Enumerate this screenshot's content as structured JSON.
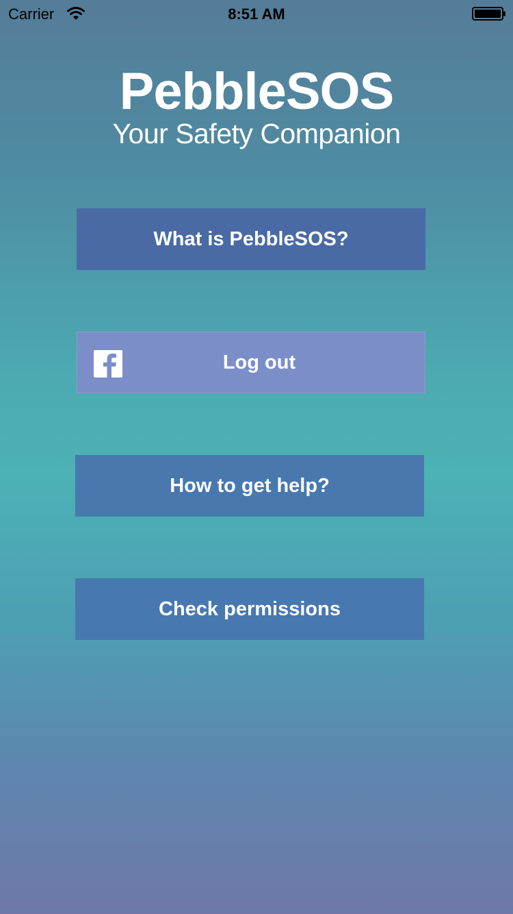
{
  "status_bar": {
    "carrier": "Carrier",
    "wifi_icon": "wifi-icon",
    "time": "8:51 AM",
    "battery_icon": "battery-icon"
  },
  "brand": {
    "title": "PebbleSOS",
    "subtitle": "Your Safety Companion"
  },
  "buttons": {
    "what_is": "What is PebbleSOS?",
    "logout": "Log out",
    "logout_icon": "facebook-icon",
    "how_to_help": "How to get help?",
    "check_permissions": "Check permissions"
  },
  "colors": {
    "button_primary": "#4a6aa6",
    "button_facebook": "#7b8ec8",
    "button_secondary": "#4878ae",
    "text": "#ffffff"
  }
}
